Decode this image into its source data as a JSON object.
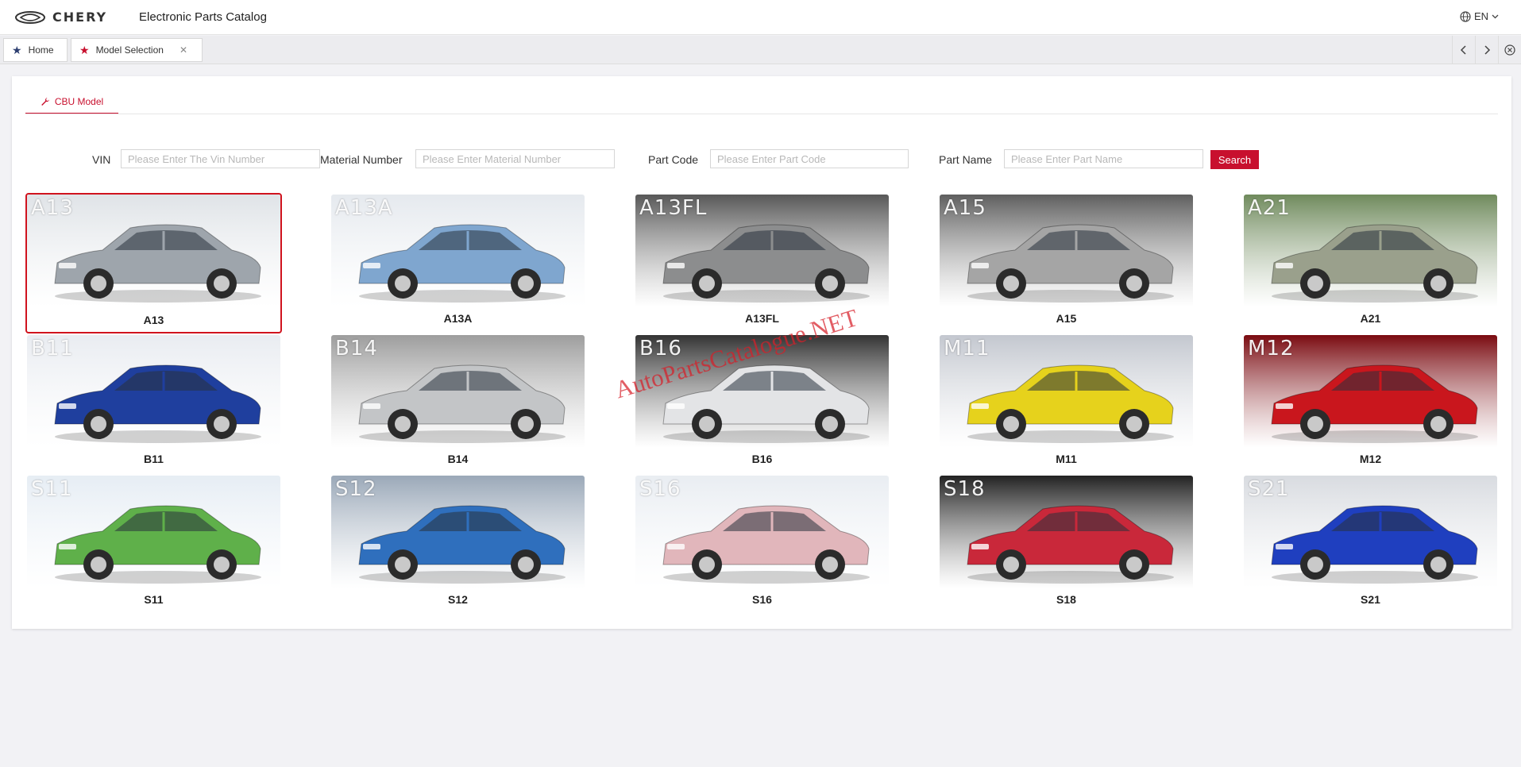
{
  "header": {
    "brand": "CHERY",
    "app_title": "Electronic Parts Catalog",
    "language": "EN"
  },
  "tabs": [
    {
      "label": "Home"
    },
    {
      "label": "Model Selection"
    }
  ],
  "subtab": {
    "label": "CBU Model"
  },
  "filters": {
    "vin_label": "VIN",
    "vin_placeholder": "Please Enter The Vin Number",
    "material_label": "Material Number",
    "material_placeholder": "Please Enter Material Number",
    "partcode_label": "Part Code",
    "partcode_placeholder": "Please Enter Part Code",
    "partname_label": "Part Name",
    "partname_placeholder": "Please Enter Part Name",
    "search_label": "Search"
  },
  "models": [
    {
      "code": "A13",
      "name": "A13",
      "car_color": "#9ea5ac",
      "bg": "#dfe3e7",
      "selected": true
    },
    {
      "code": "A13A",
      "name": "A13A",
      "car_color": "#7fa6cf",
      "bg": "#e5e9ee",
      "selected": false
    },
    {
      "code": "A13FL",
      "name": "A13FL",
      "car_color": "#8c8d8e",
      "bg": "#575757",
      "selected": false
    },
    {
      "code": "A15",
      "name": "A15",
      "car_color": "#a5a5a5",
      "bg": "#5e5e5e",
      "selected": false
    },
    {
      "code": "A21",
      "name": "A21",
      "car_color": "#9aa08c",
      "bg": "#6f8a5c",
      "selected": false
    },
    {
      "code": "B11",
      "name": "B11",
      "car_color": "#1f3f9e",
      "bg": "#e9ecf1",
      "selected": false
    },
    {
      "code": "B14",
      "name": "B14",
      "car_color": "#c3c5c7",
      "bg": "#9d9d9d",
      "selected": false
    },
    {
      "code": "B16",
      "name": "B16",
      "car_color": "#e3e4e6",
      "bg": "#333333",
      "selected": false
    },
    {
      "code": "M11",
      "name": "M11",
      "car_color": "#e6d21c",
      "bg": "#c3c7cf",
      "selected": false
    },
    {
      "code": "M12",
      "name": "M12",
      "car_color": "#c9161d",
      "bg": "#7a0a10",
      "selected": false
    },
    {
      "code": "S11",
      "name": "S11",
      "car_color": "#5fb04a",
      "bg": "#e6edf4",
      "selected": false
    },
    {
      "code": "S12",
      "name": "S12",
      "car_color": "#2f6fbd",
      "bg": "#9aa8b8",
      "selected": false
    },
    {
      "code": "S16",
      "name": "S16",
      "car_color": "#e1b6bb",
      "bg": "#e9edf2",
      "selected": false
    },
    {
      "code": "S18",
      "name": "S18",
      "car_color": "#c9283a",
      "bg": "#222222",
      "selected": false
    },
    {
      "code": "S21",
      "name": "S21",
      "car_color": "#1f3fbf",
      "bg": "#d8dbe0",
      "selected": false
    }
  ],
  "watermark": "AutoPartsCatalogue.NET",
  "colors": {
    "accent": "#c8102e",
    "background": "#f2f2f5"
  }
}
